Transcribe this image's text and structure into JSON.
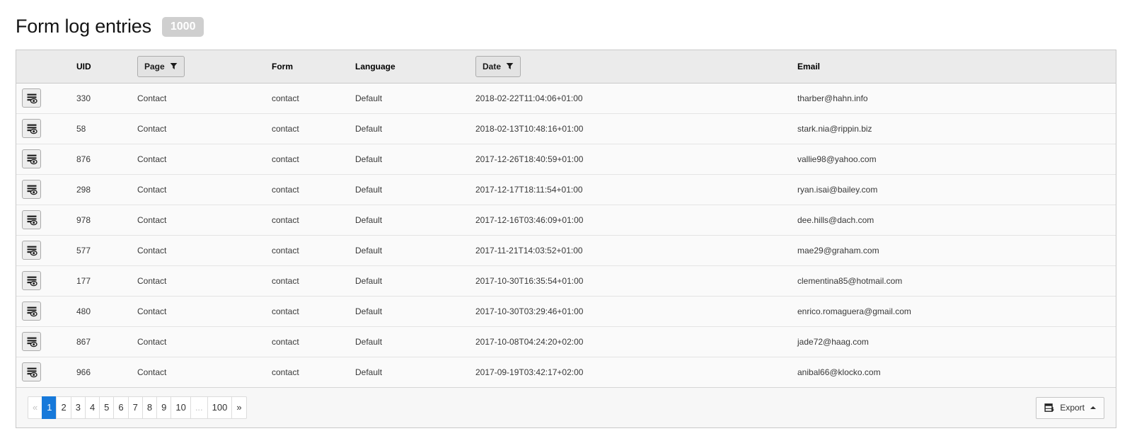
{
  "header": {
    "title": "Form log entries",
    "count_badge": "1000"
  },
  "table": {
    "columns": {
      "uid": "UID",
      "page": "Page",
      "form": "Form",
      "language": "Language",
      "date": "Date",
      "email": "Email"
    },
    "rows": [
      {
        "uid": "330",
        "page": "Contact",
        "form": "contact",
        "language": "Default",
        "date": "2018-02-22T11:04:06+01:00",
        "email": "tharber@hahn.info"
      },
      {
        "uid": "58",
        "page": "Contact",
        "form": "contact",
        "language": "Default",
        "date": "2018-02-13T10:48:16+01:00",
        "email": "stark.nia@rippin.biz"
      },
      {
        "uid": "876",
        "page": "Contact",
        "form": "contact",
        "language": "Default",
        "date": "2017-12-26T18:40:59+01:00",
        "email": "vallie98@yahoo.com"
      },
      {
        "uid": "298",
        "page": "Contact",
        "form": "contact",
        "language": "Default",
        "date": "2017-12-17T18:11:54+01:00",
        "email": "ryan.isai@bailey.com"
      },
      {
        "uid": "978",
        "page": "Contact",
        "form": "contact",
        "language": "Default",
        "date": "2017-12-16T03:46:09+01:00",
        "email": "dee.hills@dach.com"
      },
      {
        "uid": "577",
        "page": "Contact",
        "form": "contact",
        "language": "Default",
        "date": "2017-11-21T14:03:52+01:00",
        "email": "mae29@graham.com"
      },
      {
        "uid": "177",
        "page": "Contact",
        "form": "contact",
        "language": "Default",
        "date": "2017-10-30T16:35:54+01:00",
        "email": "clementina85@hotmail.com"
      },
      {
        "uid": "480",
        "page": "Contact",
        "form": "contact",
        "language": "Default",
        "date": "2017-10-30T03:29:46+01:00",
        "email": "enrico.romaguera@gmail.com"
      },
      {
        "uid": "867",
        "page": "Contact",
        "form": "contact",
        "language": "Default",
        "date": "2017-10-08T04:24:20+02:00",
        "email": "jade72@haag.com"
      },
      {
        "uid": "966",
        "page": "Contact",
        "form": "contact",
        "language": "Default",
        "date": "2017-09-19T03:42:17+02:00",
        "email": "anibal66@klocko.com"
      }
    ]
  },
  "pagination": {
    "items": [
      {
        "label": "«",
        "state": "disabled"
      },
      {
        "label": "1",
        "state": "active"
      },
      {
        "label": "2",
        "state": "normal"
      },
      {
        "label": "3",
        "state": "normal"
      },
      {
        "label": "4",
        "state": "normal"
      },
      {
        "label": "5",
        "state": "normal"
      },
      {
        "label": "6",
        "state": "normal"
      },
      {
        "label": "7",
        "state": "normal"
      },
      {
        "label": "8",
        "state": "normal"
      },
      {
        "label": "9",
        "state": "normal"
      },
      {
        "label": "10",
        "state": "normal"
      },
      {
        "label": "...",
        "state": "disabled"
      },
      {
        "label": "100",
        "state": "normal"
      },
      {
        "label": "»",
        "state": "normal"
      }
    ]
  },
  "footer": {
    "export_label": "Export"
  },
  "icons": {
    "record_view": "document-with-eye",
    "filter": "funnel",
    "export": "table-arrow-down",
    "caret": "caret-up"
  },
  "colors": {
    "accent_blue": "#1779da",
    "header_bg": "#ebebeb",
    "badge_bg": "#cfcfcf"
  }
}
